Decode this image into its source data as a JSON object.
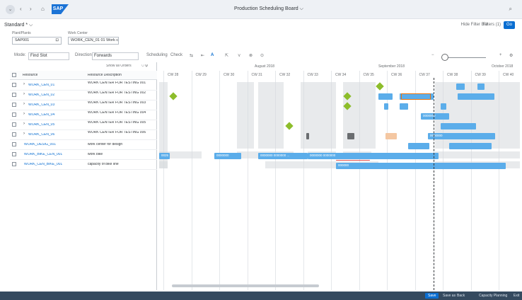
{
  "shellbar": {
    "back_icon": "chevron-left-icon",
    "home_icon": "home-icon",
    "logo": "SAP",
    "title": "Production Scheduling Board",
    "title_chevron": "⌵",
    "search_icon": "search-icon"
  },
  "header": {
    "variant": "Standard *",
    "variant_icon": "⌵",
    "right_link_1": "Hide Filter Bar",
    "right_link_2": "Filters (1)",
    "go": "Go",
    "plant_label": "Plant/Plants",
    "plant_value": "SAP001",
    "plant_help": "⊡",
    "workcenter_label": "Work Center",
    "workcenter_value": "WORK_CEN_01 01 Work cen"
  },
  "toolbar": {
    "mode_label": "Mode:",
    "mode_value": "Find Slot",
    "direction_label": "Direction:",
    "direction_value": "Forwards",
    "scheduling": "Scheduling",
    "check": "Check",
    "tools": [
      "⇆",
      "⇤",
      "A",
      "⇱",
      "⋎",
      "⊗",
      "⊙"
    ],
    "zoom_out": "−",
    "zoom_in": "+",
    "settings_icon": "⚙"
  },
  "table": {
    "filter_label": "Show all Orders",
    "col_resource": "Resource",
    "col_description": "Resource Description",
    "rows": [
      {
        "resource": "WORK_CEN_01",
        "description": "WORK CENTER FOR TESTING 001",
        "link": true
      },
      {
        "resource": "WORK_CEN_02",
        "description": "WORK CENTER FOR TESTING 002",
        "link": true
      },
      {
        "resource": "WORK_CEN_03",
        "description": "WORK CENTER FOR TESTING 003",
        "link": true
      },
      {
        "resource": "WORK_CEN_04",
        "description": "WORK CENTER FOR TESTING 004",
        "link": true
      },
      {
        "resource": "WORK_CEN_05",
        "description": "WORK CENTER FOR TESTING 005",
        "link": true
      },
      {
        "resource": "WORK_CEN_06",
        "description": "WORK CENTER FOR TESTING 006",
        "link": true
      },
      {
        "resource": "WORK_DESIG_001",
        "description": "work center for design",
        "link": true
      },
      {
        "resource": "WORK_BIKE_CEN_001",
        "description": "work bike",
        "link": true
      },
      {
        "resource": "WORK_CEN_BIKE_001",
        "description": "capacity of bike line",
        "link": true
      }
    ]
  },
  "chart": {
    "months": [
      "August 2018",
      "September 2018",
      "October 2018"
    ],
    "weeks": [
      "CW 28",
      "CW 29",
      "CW 30",
      "CW 31",
      "CW 32",
      "CW 33",
      "CW 34",
      "CW 35",
      "CW 36",
      "CW 37",
      "CW 38",
      "CW 39",
      "CW 40"
    ],
    "bar_labels": [
      "0025",
      "0000000",
      "0000000 0000000 ...",
      "0000000 0000000",
      "000000",
      "0000000",
      "0000000",
      "0000000"
    ]
  },
  "footer": {
    "save": "Save",
    "save_as": "Save as",
    "back": "Back",
    "capacity": "Capacity Planning",
    "exit": "Exit"
  }
}
